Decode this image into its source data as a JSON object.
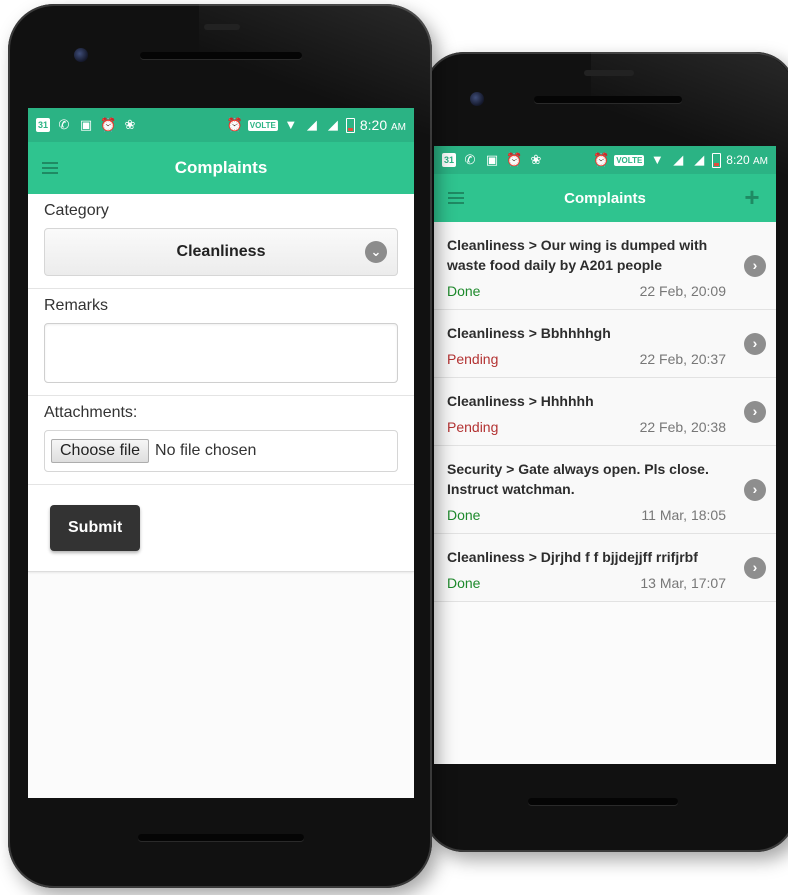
{
  "colors": {
    "statusbar": "#2bb384",
    "appbar": "#2fc48f",
    "done": "#1e8a2c",
    "pending": "#b33232",
    "submit": "#333333"
  },
  "statusbar": {
    "calendar_day": "31",
    "volte": "VOLTE",
    "time": "8:20",
    "ampm": "AM"
  },
  "left_screen": {
    "title": "Complaints",
    "category_label": "Category",
    "category_value": "Cleanliness",
    "remarks_label": "Remarks",
    "remarks_value": "",
    "attachments_label": "Attachments:",
    "choose_file_label": "Choose file",
    "file_status": "No file chosen",
    "submit_label": "Submit"
  },
  "right_screen": {
    "title": "Complaints",
    "add_label": "+",
    "items": [
      {
        "title": "Cleanliness > Our wing is dumped with waste food daily by A201 people",
        "status": "Done",
        "date": "22 Feb, 20:09"
      },
      {
        "title": "Cleanliness > Bbhhhhgh",
        "status": "Pending",
        "date": "22 Feb, 20:37"
      },
      {
        "title": "Cleanliness > Hhhhhh",
        "status": "Pending",
        "date": "22 Feb, 20:38"
      },
      {
        "title": "Security > Gate always open. Pls close. Instruct watchman.",
        "status": "Done",
        "date": "11 Mar, 18:05"
      },
      {
        "title": "Cleanliness > Djrjhd f f bjjdejjff rrifjrbf",
        "status": "Done",
        "date": "13 Mar, 17:07"
      }
    ]
  }
}
